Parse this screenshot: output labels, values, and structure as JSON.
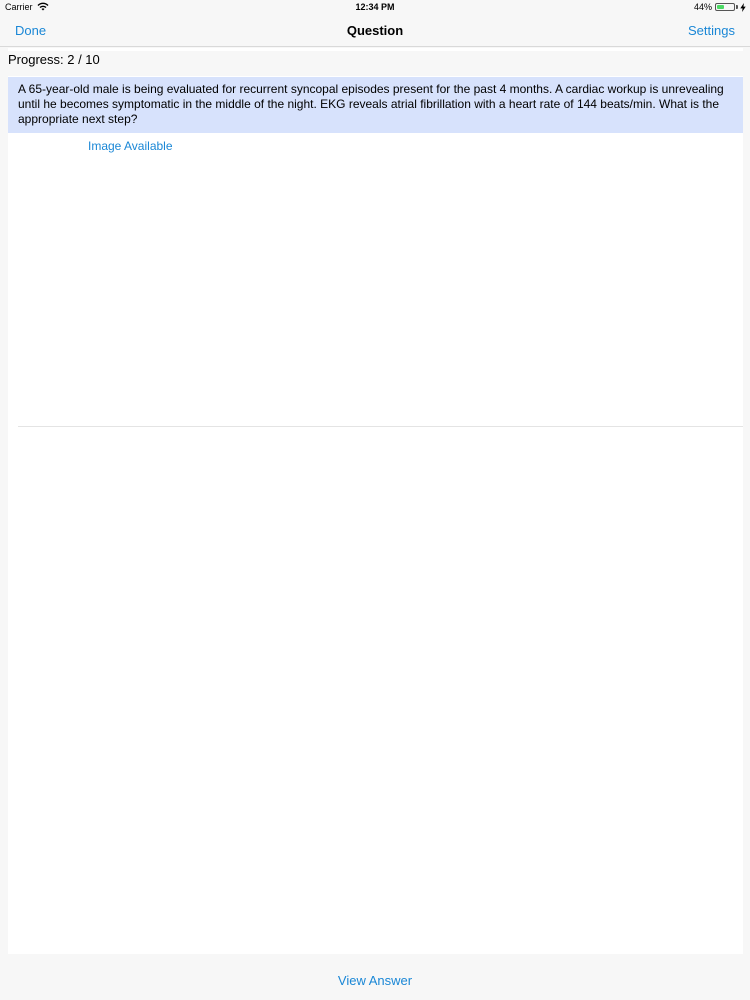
{
  "status_bar": {
    "carrier": "Carrier",
    "time": "12:34 PM",
    "battery_text": "44%",
    "battery_level": 0.44,
    "battery_color": "#4cd964"
  },
  "nav": {
    "done_label": "Done",
    "title": "Question",
    "settings_label": "Settings"
  },
  "progress": {
    "label": "Progress: 2 / 10"
  },
  "question": {
    "text": "A 65-year-old male is being evaluated for recurrent syncopal episodes present for the past 4 months. A cardiac workup is unrevealing until he becomes symptomatic in the middle of the night. EKG reveals atrial fibrillation with a heart rate of 144 beats/min. What is the appropriate next step?",
    "highlight_color": "#d7e2fc"
  },
  "image_link": {
    "label": "Image Available"
  },
  "footer": {
    "view_answer_label": "View Answer"
  },
  "colors": {
    "accent": "#1a87d6",
    "background": "#f7f7f7"
  }
}
